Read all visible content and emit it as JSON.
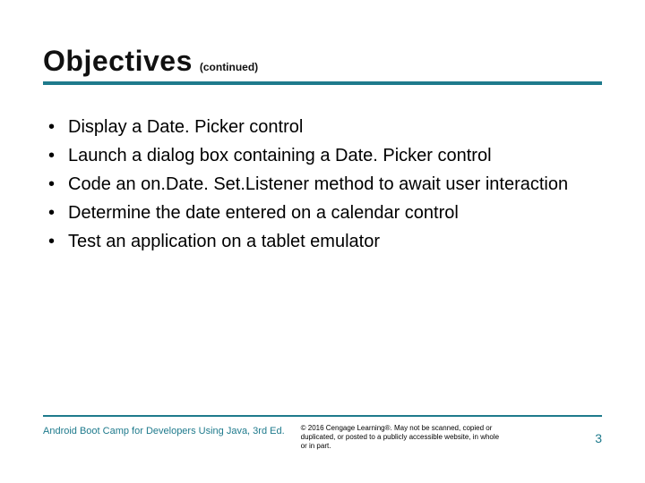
{
  "header": {
    "title": "Objectives",
    "continued": "(continued)"
  },
  "bullets": [
    "Display a Date. Picker control",
    "Launch a dialog box containing a Date. Picker control",
    "Code an on.Date. Set.Listener method to await user interaction",
    "Determine the date entered on a calendar control",
    "Test an application on a tablet emulator"
  ],
  "footer": {
    "book": "Android Boot Camp for Developers Using Java, 3rd Ed.",
    "copyright": "© 2016 Cengage Learning®. May not be scanned, copied or duplicated, or posted to a publicly accessible website, in whole or in part.",
    "page": "3"
  }
}
